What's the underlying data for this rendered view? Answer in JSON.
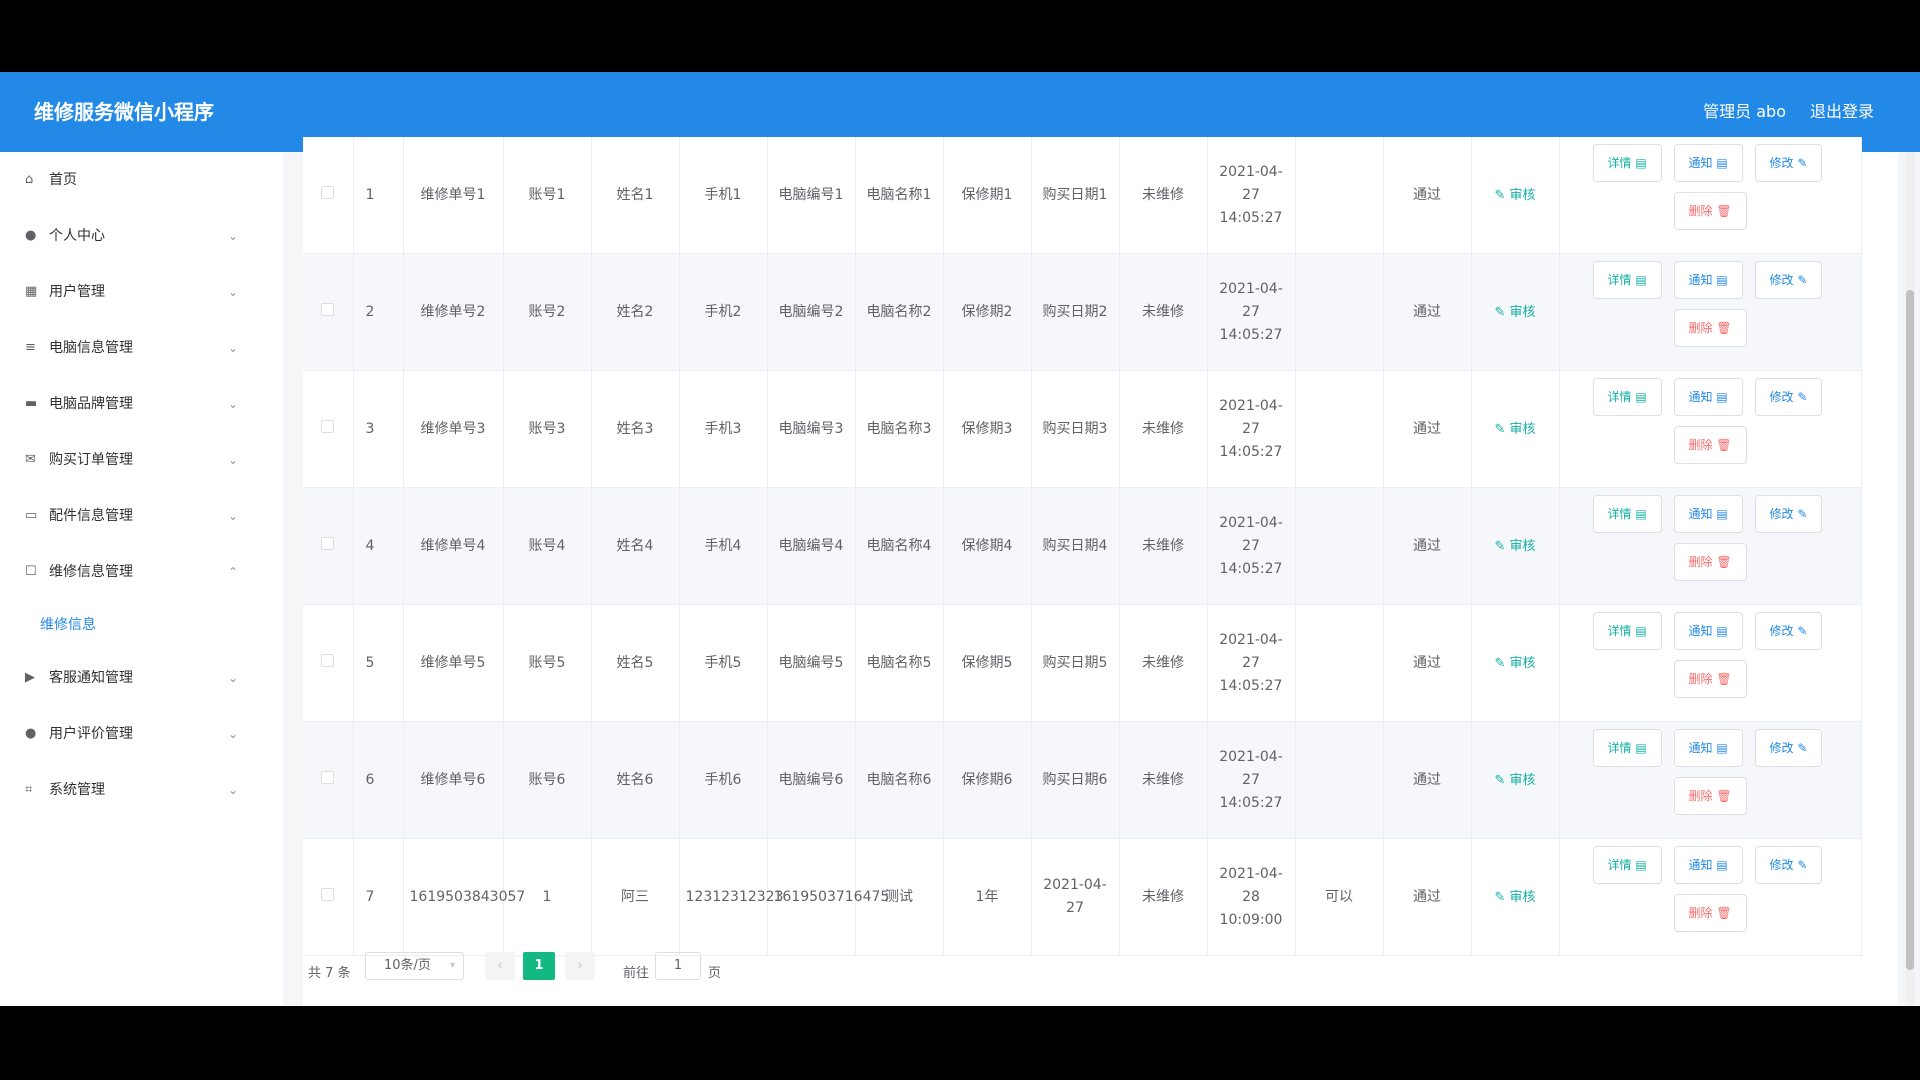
{
  "header": {
    "app_title": "维修服务微信小程序",
    "admin_label": "管理员 abo",
    "logout_label": "退出登录"
  },
  "sidebar": {
    "items": [
      {
        "label": "首页",
        "icon": "home-icon",
        "has_arrow": false
      },
      {
        "label": "个人中心",
        "icon": "user-icon",
        "has_arrow": true
      },
      {
        "label": "用户管理",
        "icon": "grid-icon",
        "has_arrow": true
      },
      {
        "label": "电脑信息管理",
        "icon": "sliders-icon",
        "has_arrow": true
      },
      {
        "label": "电脑品牌管理",
        "icon": "briefcase-icon",
        "has_arrow": true
      },
      {
        "label": "购买订单管理",
        "icon": "mail-icon",
        "has_arrow": true
      },
      {
        "label": "配件信息管理",
        "icon": "chat-icon",
        "has_arrow": true
      },
      {
        "label": "维修信息管理",
        "icon": "message-icon",
        "has_arrow": true,
        "expanded": true
      },
      {
        "label": "客服通知管理",
        "icon": "video-icon",
        "has_arrow": true
      },
      {
        "label": "用户评价管理",
        "icon": "user-icon",
        "has_arrow": true
      },
      {
        "label": "系统管理",
        "icon": "crop-icon",
        "has_arrow": true
      }
    ],
    "sub_item": "维修信息"
  },
  "table": {
    "rows": [
      {
        "idx": "1",
        "no": "维修单号1",
        "acc": "账号1",
        "name": "姓名1",
        "phone": "手机1",
        "pcno": "电脑编号1",
        "pcname": "电脑名称1",
        "warranty": "保修期1",
        "buydate": "购买日期1",
        "status": "未维修",
        "time": "2021-04-27 14:05:27",
        "remark": "",
        "review": "通过"
      },
      {
        "idx": "2",
        "no": "维修单号2",
        "acc": "账号2",
        "name": "姓名2",
        "phone": "手机2",
        "pcno": "电脑编号2",
        "pcname": "电脑名称2",
        "warranty": "保修期2",
        "buydate": "购买日期2",
        "status": "未维修",
        "time": "2021-04-27 14:05:27",
        "remark": "",
        "review": "通过"
      },
      {
        "idx": "3",
        "no": "维修单号3",
        "acc": "账号3",
        "name": "姓名3",
        "phone": "手机3",
        "pcno": "电脑编号3",
        "pcname": "电脑名称3",
        "warranty": "保修期3",
        "buydate": "购买日期3",
        "status": "未维修",
        "time": "2021-04-27 14:05:27",
        "remark": "",
        "review": "通过"
      },
      {
        "idx": "4",
        "no": "维修单号4",
        "acc": "账号4",
        "name": "姓名4",
        "phone": "手机4",
        "pcno": "电脑编号4",
        "pcname": "电脑名称4",
        "warranty": "保修期4",
        "buydate": "购买日期4",
        "status": "未维修",
        "time": "2021-04-27 14:05:27",
        "remark": "",
        "review": "通过"
      },
      {
        "idx": "5",
        "no": "维修单号5",
        "acc": "账号5",
        "name": "姓名5",
        "phone": "手机5",
        "pcno": "电脑编号5",
        "pcname": "电脑名称5",
        "warranty": "保修期5",
        "buydate": "购买日期5",
        "status": "未维修",
        "time": "2021-04-27 14:05:27",
        "remark": "",
        "review": "通过"
      },
      {
        "idx": "6",
        "no": "维修单号6",
        "acc": "账号6",
        "name": "姓名6",
        "phone": "手机6",
        "pcno": "电脑编号6",
        "pcname": "电脑名称6",
        "warranty": "保修期6",
        "buydate": "购买日期6",
        "status": "未维修",
        "time": "2021-04-27 14:05:27",
        "remark": "",
        "review": "通过"
      },
      {
        "idx": "7",
        "no": "1619503843057",
        "acc": "1",
        "name": "阿三",
        "phone": "12312312323",
        "pcno": "1619503716475",
        "pcname": "测试",
        "warranty": "1年",
        "buydate": "2021-04-27",
        "status": "未维修",
        "time": "2021-04-28 10:09:00",
        "remark": "可以",
        "review": "通过"
      }
    ],
    "btn_audit": "审核",
    "btn_detail": "详情",
    "btn_notify": "通知",
    "btn_edit": "修改",
    "btn_delete": "删除"
  },
  "pager": {
    "total": "共 7 条",
    "page_size": "10条/页",
    "current": "1",
    "goto_label": "前往",
    "goto_value": "1",
    "page_unit": "页"
  }
}
